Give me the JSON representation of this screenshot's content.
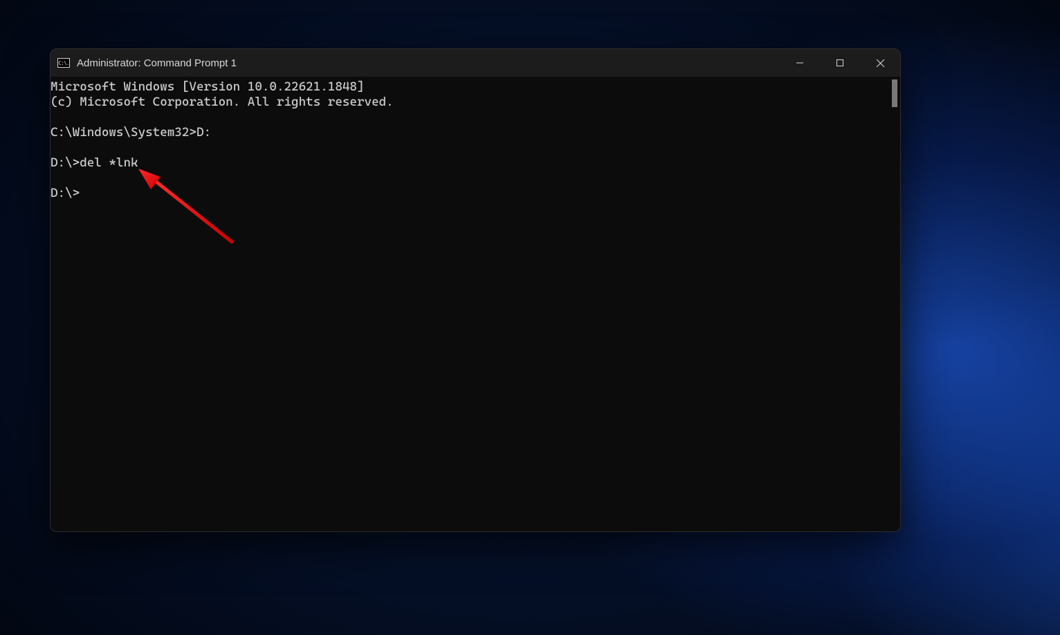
{
  "window": {
    "title": "Administrator: Command Prompt 1",
    "icon_glyph": "C:\\."
  },
  "terminal": {
    "lines": [
      "Microsoft Windows [Version 10.0.22621.1848]",
      "(c) Microsoft Corporation. All rights reserved.",
      "",
      "C:\\Windows\\System32>D:",
      "",
      "D:\\>del *lnk",
      "",
      "D:\\>"
    ]
  }
}
